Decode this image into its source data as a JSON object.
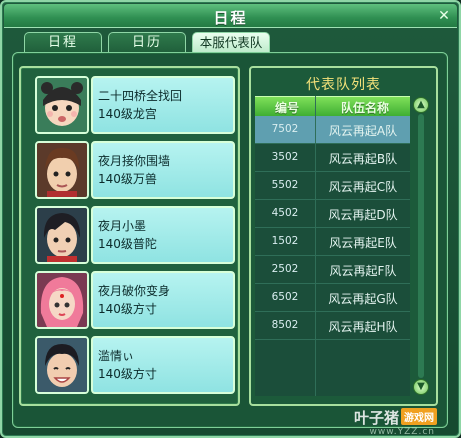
{
  "window": {
    "title": "日程",
    "close_symbol": "✕"
  },
  "tabs": [
    {
      "label": "日程",
      "active": false
    },
    {
      "label": "日历",
      "active": false
    },
    {
      "label": "本服代表队",
      "active": true
    }
  ],
  "players": [
    {
      "name": "二十四桥全找回",
      "level": "140级龙宫",
      "avatar_icon": "panda-hat-avatar-icon"
    },
    {
      "name": "夜月接你围墙",
      "level": "140级万兽",
      "avatar_icon": "brown-hair-boy-avatar-icon"
    },
    {
      "name": "夜月小墨",
      "level": "140级普陀",
      "avatar_icon": "black-hair-boy-avatar-icon"
    },
    {
      "name": "夜月破你变身",
      "level": "140级方寸",
      "avatar_icon": "pink-hair-girl-avatar-icon"
    },
    {
      "name": "滥情ぃ",
      "level": "140级方寸",
      "avatar_icon": "smiling-boy-avatar-icon"
    }
  ],
  "team_panel": {
    "title": "代表队列表",
    "columns": [
      "编号",
      "队伍名称"
    ],
    "rows": [
      {
        "num": "7502",
        "name": "风云再起A队",
        "selected": true
      },
      {
        "num": "3502",
        "name": "风云再起B队",
        "selected": false
      },
      {
        "num": "5502",
        "name": "风云再起C队",
        "selected": false
      },
      {
        "num": "4502",
        "name": "风云再起D队",
        "selected": false
      },
      {
        "num": "1502",
        "name": "风云再起E队",
        "selected": false
      },
      {
        "num": "2502",
        "name": "风云再起F队",
        "selected": false
      },
      {
        "num": "6502",
        "name": "风云再起G队",
        "selected": false
      },
      {
        "num": "8502",
        "name": "风云再起H队",
        "selected": false
      }
    ]
  },
  "watermark": {
    "brand": "叶子猪",
    "tag": "游戏网",
    "url": "www.YZZ.cn"
  },
  "colors": {
    "accent_green": "#3fae32",
    "selected_row": "#5f9fb0",
    "title_yellow": "#f5e27a"
  }
}
